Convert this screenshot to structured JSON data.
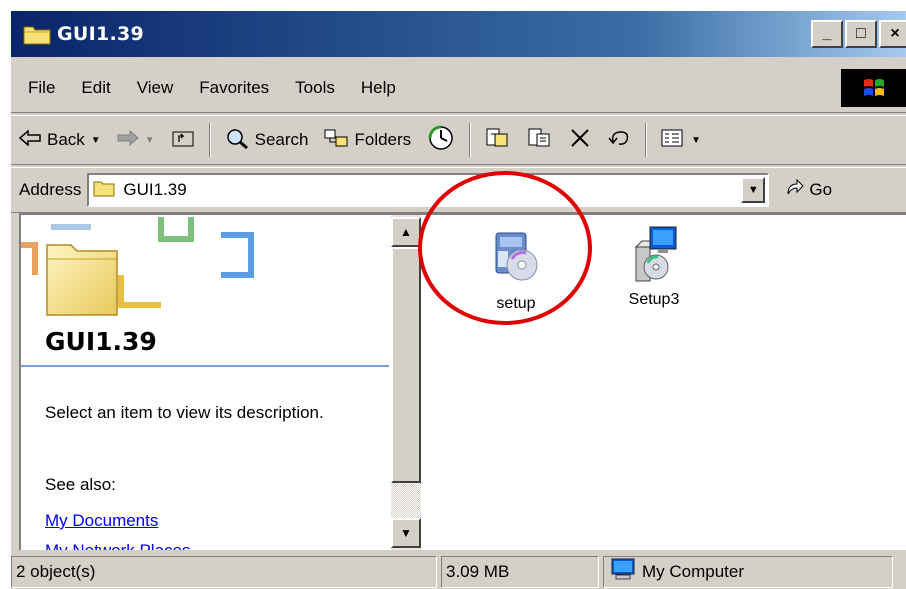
{
  "window": {
    "title": "GUI1.39",
    "controls": {
      "minimize": "_",
      "maximize": "□",
      "close": "×"
    }
  },
  "menubar": {
    "items": [
      {
        "label": "File",
        "accel": "F"
      },
      {
        "label": "Edit",
        "accel": "E"
      },
      {
        "label": "View",
        "accel": "V"
      },
      {
        "label": "Favorites",
        "accel": "a"
      },
      {
        "label": "Tools",
        "accel": "T"
      },
      {
        "label": "Help",
        "accel": "H"
      }
    ]
  },
  "toolbar": {
    "back_label": "Back",
    "search_label": "Search",
    "folders_label": "Folders"
  },
  "address": {
    "label": "Address",
    "value": "GUI1.39",
    "go_label": "Go"
  },
  "left_panel": {
    "title": "GUI1.39",
    "description": "Select an item to view its description.",
    "see_also": "See also:",
    "links": [
      "My Documents",
      "My Network Places"
    ]
  },
  "files": [
    {
      "name": "setup",
      "icon": "installer-cd-icon",
      "highlighted": true
    },
    {
      "name": "Setup3",
      "icon": "setup-computer-cd-icon",
      "highlighted": false
    }
  ],
  "statusbar": {
    "objects": "2 object(s)",
    "size": "3.09 MB",
    "zone": "My Computer"
  },
  "colors": {
    "title_gradient_start": "#0a246a",
    "title_gradient_end": "#a6caf0",
    "face": "#d4d0c8",
    "link": "#0000ee",
    "annotation_circle": "#e10000"
  }
}
